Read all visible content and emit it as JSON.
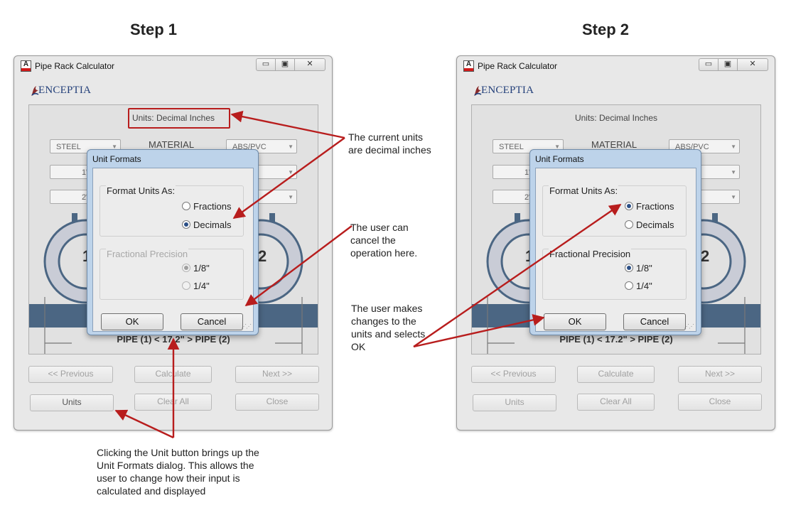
{
  "steps": [
    {
      "title": "Step 1",
      "window_title": "Pipe Rack Calculator",
      "logo_text": "ENCEPTIA",
      "units_label": "Units: Decimal Inches",
      "material_label": "MATERIAL",
      "combo_left1": "STEEL",
      "combo_right1": "ABS/PVC",
      "combo_left2": "1\"",
      "combo_left3": "2\"",
      "pipe1_num": "1",
      "pipe2_num": "2",
      "pipe_label": "PIPE (1) <  17.2\"  > PIPE (2)",
      "buttons": {
        "previous": "<< Previous",
        "calculate": "Calculate",
        "next": "Next >>",
        "units": "Units",
        "clear_all": "Clear All",
        "close": "Close"
      },
      "dialog": {
        "title": "Unit Formats",
        "format_group": "Format Units As:",
        "fractions": "Fractions",
        "decimals": "Decimals",
        "selected_format": "Decimals",
        "precision_group": "Fractional Precision",
        "precision_enabled": false,
        "p1": "1/8\"",
        "p2": "1/4\"",
        "selected_precision": "1/8\"",
        "ok": "OK",
        "cancel": "Cancel"
      }
    },
    {
      "title": "Step 2",
      "window_title": "Pipe Rack Calculator",
      "logo_text": "ENCEPTIA",
      "units_label": "Units: Decimal Inches",
      "material_label": "MATERIAL",
      "combo_left1": "STEEL",
      "combo_right1": "ABS/PVC",
      "combo_left2": "1\"",
      "combo_left3": "2\"",
      "pipe1_num": "1",
      "pipe2_num": "2",
      "pipe_label": "PIPE (1) <  17.2\"  > PIPE (2)",
      "buttons": {
        "previous": "<< Previous",
        "calculate": "Calculate",
        "next": "Next >>",
        "units": "Units",
        "clear_all": "Clear All",
        "close": "Close"
      },
      "dialog": {
        "title": "Unit Formats",
        "format_group": "Format Units As:",
        "fractions": "Fractions",
        "decimals": "Decimals",
        "selected_format": "Fractions",
        "precision_group": "Fractional Precision",
        "precision_enabled": true,
        "p1": "1/8\"",
        "p2": "1/4\"",
        "selected_precision": "1/8\"",
        "ok": "OK",
        "cancel": "Cancel"
      }
    }
  ],
  "callouts": {
    "current_units": "The current units are decimal inches",
    "cancel": "The user can cancel the operation here.",
    "changes": "The user makes changes to the units and selects OK",
    "units_button": "Clicking the Unit button brings up the Unit Formats dialog.  This allows the user to change how their input is calculated and displayed"
  },
  "colors": {
    "annotation_red": "#b81d1d",
    "pipe_blue": "#4b6683",
    "dialog_frame": "#bdd3ea"
  }
}
